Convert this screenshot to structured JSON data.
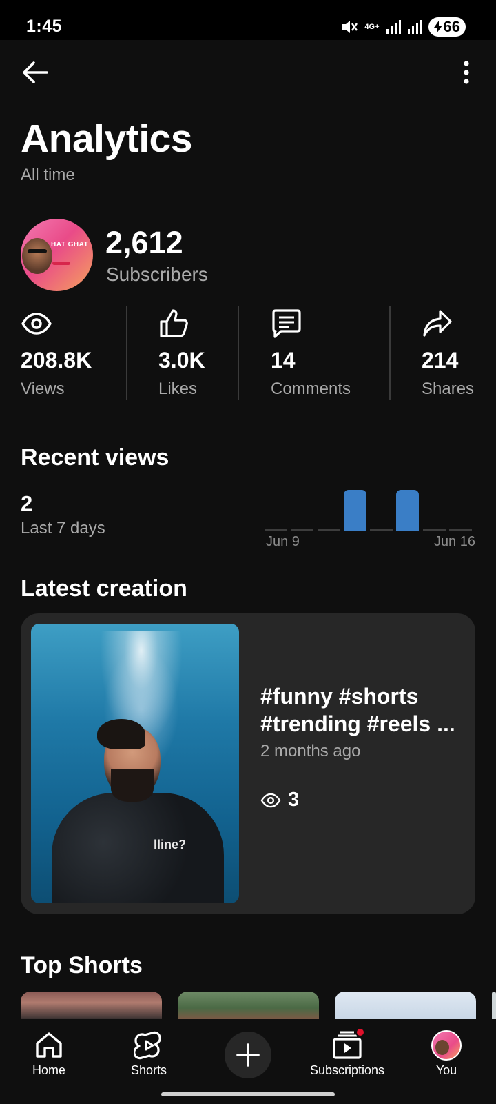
{
  "status_bar": {
    "time": "1:45",
    "network": "4G+",
    "battery": "66"
  },
  "header": {
    "title": "Analytics",
    "subtitle": "All time"
  },
  "channel": {
    "avatar_text": "HAT GHAT",
    "subscriber_count": "2,612",
    "subscriber_label": "Subscribers"
  },
  "stats": [
    {
      "icon": "eye-icon",
      "value": "208.8K",
      "label": "Views"
    },
    {
      "icon": "thumbs-up-icon",
      "value": "3.0K",
      "label": "Likes"
    },
    {
      "icon": "comment-icon",
      "value": "14",
      "label": "Comments"
    },
    {
      "icon": "share-icon",
      "value": "214",
      "label": "Shares"
    }
  ],
  "recent_views": {
    "title": "Recent views",
    "count": "2",
    "period": "Last 7 days",
    "axis_start": "Jun 9",
    "axis_end": "Jun 16"
  },
  "chart_data": {
    "type": "bar",
    "title": "",
    "xlabel": "",
    "ylabel": "",
    "x_tick_labels": [
      "Jun 9",
      "Jun 16"
    ],
    "values": [
      0,
      0,
      0,
      1,
      0,
      1,
      0,
      0
    ],
    "ylim": [
      0,
      1
    ],
    "color": "#3a7ec6"
  },
  "latest_creation": {
    "section_title": "Latest creation",
    "title_line1": "#funny #shorts",
    "title_line2": "#trending #reels ...",
    "age": "2 months ago",
    "views": "3",
    "shirt_logo": "lline?"
  },
  "top_shorts": {
    "section_title": "Top Shorts"
  },
  "bottom_nav": {
    "home": "Home",
    "shorts": "Shorts",
    "subscriptions": "Subscriptions",
    "you": "You"
  },
  "colors": {
    "background": "#0f0f0f",
    "card": "#272727",
    "accent_blue": "#3a7ec6",
    "notification_red": "#e0112b"
  }
}
